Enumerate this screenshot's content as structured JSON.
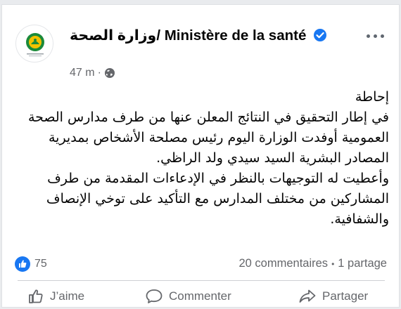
{
  "post": {
    "author_name": "وزارة الصحة/ Ministère de la santé",
    "timestamp": "47 m",
    "separator": "·",
    "icons": {
      "avatar": "ministry-seal-icon",
      "verified": "verified-badge-icon",
      "privacy": "globe-icon",
      "more": "more-options-icon"
    },
    "body_text": "إحاطة\nفي إطار التحقيق في النتائج المعلن عنها من طرف مدارس الصحة العمومية أوفدت الوزارة اليوم رئيس مصلحة الأشخاص بمديرية المصادر البشرية السيد سيدي ولد الراظي.\nوأعطيت له التوجيهات بالنظر في الإدعاءات المقدمة من طرف المشاركين من مختلف المدارس مع التأكيد على توخي الإنصاف والشفافية.",
    "colors": {
      "verified": "#1877f2",
      "like_badge": "#1877f2",
      "secondary_text": "#65676b"
    }
  },
  "engagement": {
    "reaction_count": "75",
    "comments_label": "20 commentaires",
    "bullet": "•",
    "shares_label": "1 partage"
  },
  "actions": {
    "like_label": "J’aime",
    "comment_label": "Commenter",
    "share_label": "Partager"
  }
}
